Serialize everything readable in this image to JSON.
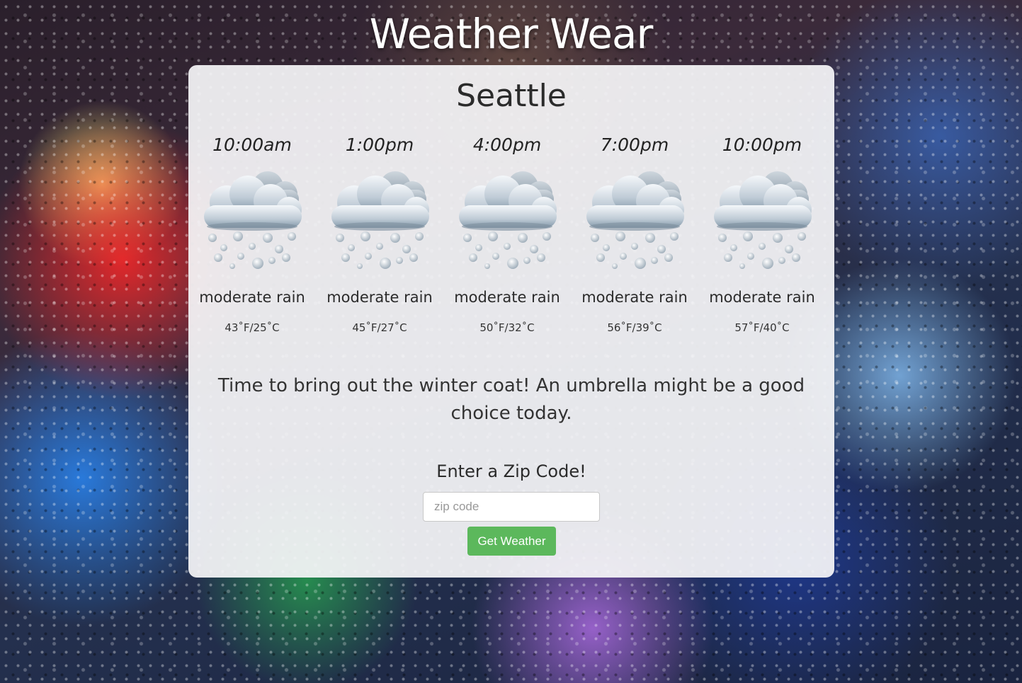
{
  "app": {
    "title": "Weather Wear"
  },
  "location": {
    "city": "Seattle"
  },
  "forecast": [
    {
      "time": "10:00am",
      "description": "moderate rain",
      "temp": "43˚F/25˚C",
      "icon": "rain-cloud-icon"
    },
    {
      "time": "1:00pm",
      "description": "moderate rain",
      "temp": "45˚F/27˚C",
      "icon": "rain-cloud-icon"
    },
    {
      "time": "4:00pm",
      "description": "moderate rain",
      "temp": "50˚F/32˚C",
      "icon": "rain-cloud-icon"
    },
    {
      "time": "7:00pm",
      "description": "moderate rain",
      "temp": "56˚F/39˚C",
      "icon": "rain-cloud-icon"
    },
    {
      "time": "10:00pm",
      "description": "moderate rain",
      "temp": "57˚F/40˚C",
      "icon": "rain-cloud-icon"
    }
  ],
  "advice": "Time to bring out the winter coat! An umbrella might be a good choice today.",
  "zip_form": {
    "label": "Enter a Zip Code!",
    "placeholder": "zip code",
    "value": "",
    "button_label": "Get Weather",
    "button_color": "#5cb85c"
  }
}
